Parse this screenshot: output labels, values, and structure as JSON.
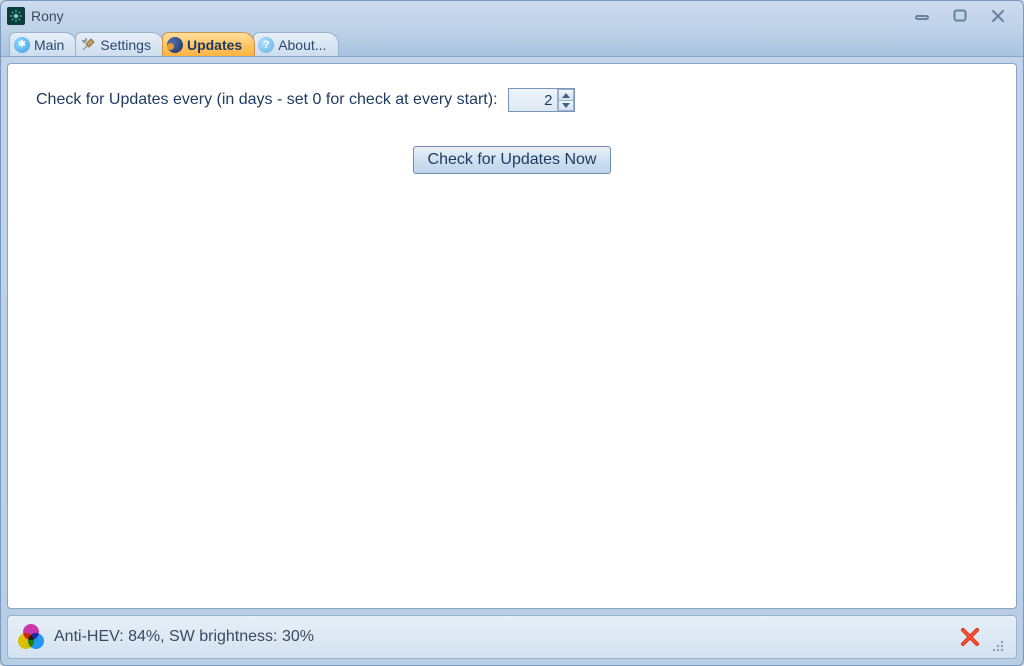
{
  "app": {
    "title": "Rony"
  },
  "tabs": {
    "main": {
      "label": "Main"
    },
    "settings": {
      "label": "Settings"
    },
    "updates": {
      "label": "Updates"
    },
    "about": {
      "label": "About..."
    }
  },
  "updates_panel": {
    "check_label": "Check for Updates every (in days - set 0 for check at every start):",
    "interval_value": "2",
    "check_now_button": "Check for Updates Now"
  },
  "statusbar": {
    "text": "Anti-HEV: 84%, SW brightness: 30%"
  }
}
